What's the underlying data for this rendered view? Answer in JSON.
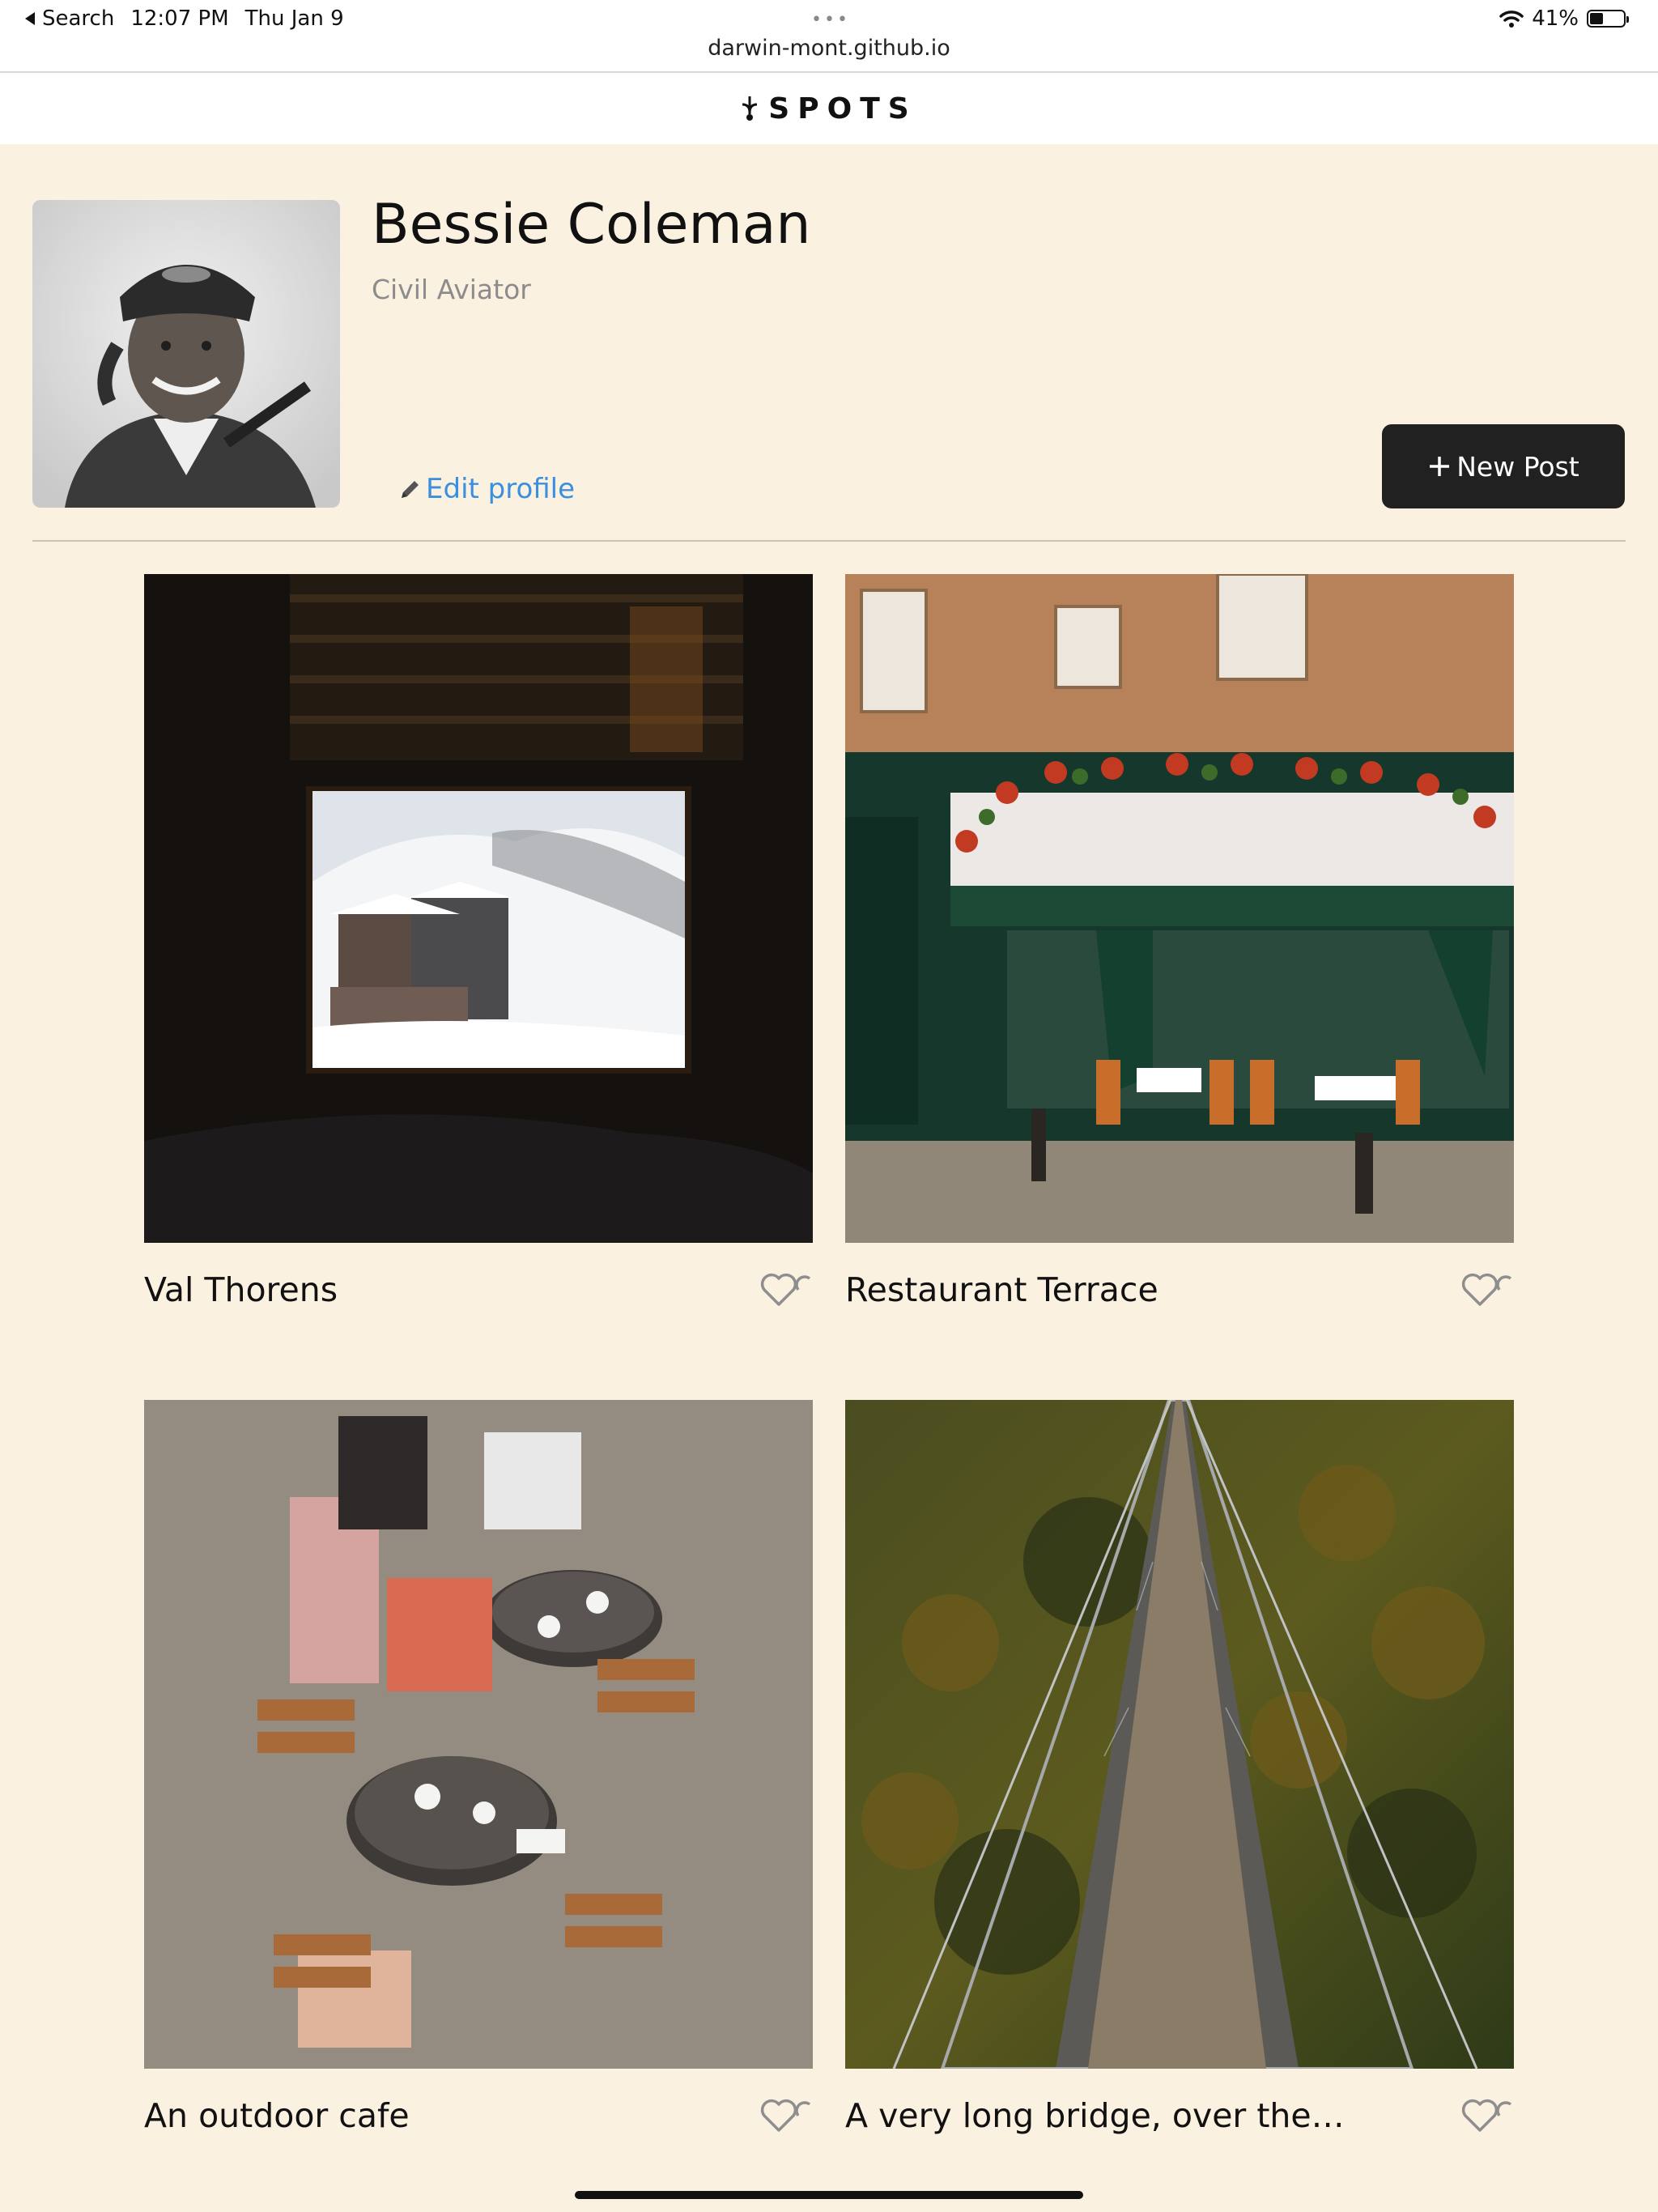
{
  "status_bar": {
    "back_label": "Search",
    "time": "12:07 PM",
    "date": "Thu Jan 9",
    "battery": "41%",
    "battery_level": 0.41
  },
  "browser": {
    "url": "darwin-mont.github.io",
    "menu_dots": "•••"
  },
  "header": {
    "logo_text": "SPOTS",
    "logo_icon": "sprout-icon"
  },
  "profile": {
    "name": "Bessie Coleman",
    "description": "Civil Aviator",
    "edit_label": "Edit profile",
    "edit_icon": "pencil-icon",
    "new_post_label": "New Post",
    "new_post_icon": "plus-icon"
  },
  "cards": [
    {
      "title": "Val Thorens",
      "image": "window-view-snowy-village",
      "liked": false
    },
    {
      "title": "Restaurant Terrace",
      "image": "restaurant-storefront",
      "liked": false
    },
    {
      "title": "An outdoor cafe",
      "image": "outdoor-cafe-tables",
      "liked": false
    },
    {
      "title": "A very long bridge, over the…",
      "image": "suspension-bridge-forest",
      "liked": false
    }
  ],
  "colors": {
    "background": "#fbf1e0",
    "accent_link": "#3b8fe0",
    "button": "#212121",
    "secondary_text": "#8c8c8c"
  }
}
